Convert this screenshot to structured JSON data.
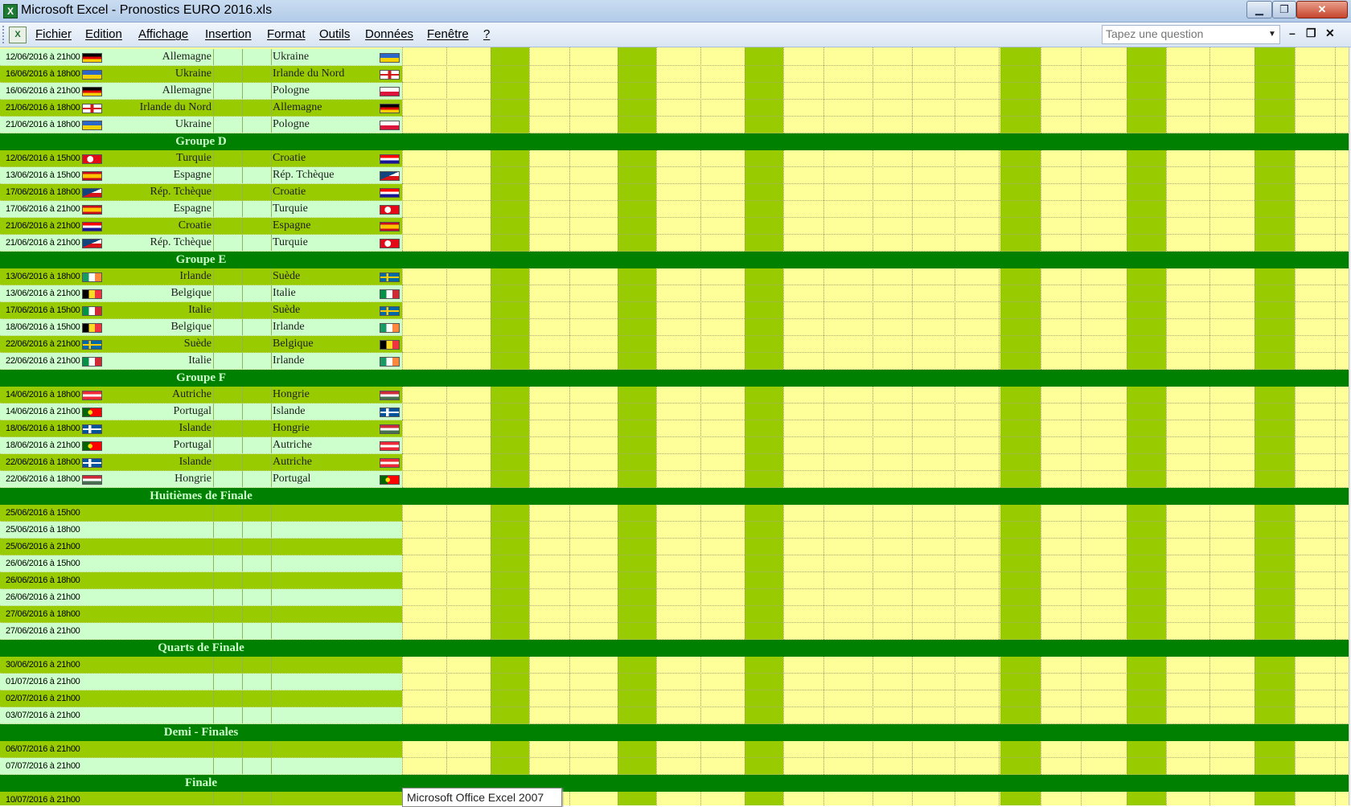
{
  "window": {
    "title": "Microsoft Excel - Pronostics EURO 2016.xls",
    "min_label": "▁",
    "max_label": "❐",
    "close_label": "✕"
  },
  "menu": {
    "items": [
      "Fichier",
      "Edition",
      "Affichage",
      "Insertion",
      "Format",
      "Outils",
      "Données",
      "Fenêtre",
      "?"
    ],
    "search_placeholder": "Tapez une question",
    "mdi_min": "–",
    "mdi_restore": "❐",
    "mdi_close": "✕"
  },
  "colors": {
    "row_light": "#ccffcc",
    "row_dark": "#99cc00",
    "group_bar": "#008000",
    "grid_bg": "#ffff99"
  },
  "sections": [
    {
      "group": null,
      "matches": [
        {
          "date": "12/06/2016 à 21h00",
          "team1": "Allemagne",
          "team2": "Ukraine",
          "flag1": "germany",
          "flag2": "ukraine"
        },
        {
          "date": "16/06/2016 à 18h00",
          "team1": "Ukraine",
          "team2": "Irlande du Nord",
          "flag1": "ukraine",
          "flag2": "northern-ireland"
        },
        {
          "date": "16/06/2016 à 21h00",
          "team1": "Allemagne",
          "team2": "Pologne",
          "flag1": "germany",
          "flag2": "poland"
        },
        {
          "date": "21/06/2016 à 18h00",
          "team1": "Irlande du Nord",
          "team2": "Allemagne",
          "flag1": "northern-ireland",
          "flag2": "germany"
        },
        {
          "date": "21/06/2016 à 18h00",
          "team1": "Ukraine",
          "team2": "Pologne",
          "flag1": "ukraine",
          "flag2": "poland"
        }
      ]
    },
    {
      "group": "Groupe D",
      "matches": [
        {
          "date": "12/06/2016 à 15h00",
          "team1": "Turquie",
          "team2": "Croatie",
          "flag1": "turkey",
          "flag2": "croatia"
        },
        {
          "date": "13/06/2016 à 15h00",
          "team1": "Espagne",
          "team2": "Rép. Tchèque",
          "flag1": "spain",
          "flag2": "czech"
        },
        {
          "date": "17/06/2016 à 18h00",
          "team1": "Rép. Tchèque",
          "team2": "Croatie",
          "flag1": "czech",
          "flag2": "croatia"
        },
        {
          "date": "17/06/2016 à 21h00",
          "team1": "Espagne",
          "team2": "Turquie",
          "flag1": "spain",
          "flag2": "turkey"
        },
        {
          "date": "21/06/2016 à 21h00",
          "team1": "Croatie",
          "team2": "Espagne",
          "flag1": "croatia",
          "flag2": "spain"
        },
        {
          "date": "21/06/2016 à 21h00",
          "team1": "Rép. Tchèque",
          "team2": "Turquie",
          "flag1": "czech",
          "flag2": "turkey"
        }
      ]
    },
    {
      "group": "Groupe E",
      "matches": [
        {
          "date": "13/06/2016 à 18h00",
          "team1": "Irlande",
          "team2": "Suède",
          "flag1": "ireland",
          "flag2": "sweden"
        },
        {
          "date": "13/06/2016 à 21h00",
          "team1": "Belgique",
          "team2": "Italie",
          "flag1": "belgium",
          "flag2": "italy"
        },
        {
          "date": "17/06/2016 à 15h00",
          "team1": "Italie",
          "team2": "Suède",
          "flag1": "italy",
          "flag2": "sweden"
        },
        {
          "date": "18/06/2016 à 15h00",
          "team1": "Belgique",
          "team2": "Irlande",
          "flag1": "belgium",
          "flag2": "ireland"
        },
        {
          "date": "22/06/2016 à 21h00",
          "team1": "Suède",
          "team2": "Belgique",
          "flag1": "sweden",
          "flag2": "belgium"
        },
        {
          "date": "22/06/2016 à 21h00",
          "team1": "Italie",
          "team2": "Irlande",
          "flag1": "italy",
          "flag2": "ireland"
        }
      ]
    },
    {
      "group": "Groupe F",
      "matches": [
        {
          "date": "14/06/2016 à 18h00",
          "team1": "Autriche",
          "team2": "Hongrie",
          "flag1": "austria",
          "flag2": "hungary"
        },
        {
          "date": "14/06/2016 à 21h00",
          "team1": "Portugal",
          "team2": "Islande",
          "flag1": "portugal",
          "flag2": "iceland"
        },
        {
          "date": "18/06/2016 à 18h00",
          "team1": "Islande",
          "team2": "Hongrie",
          "flag1": "iceland",
          "flag2": "hungary"
        },
        {
          "date": "18/06/2016 à 21h00",
          "team1": "Portugal",
          "team2": "Autriche",
          "flag1": "portugal",
          "flag2": "austria"
        },
        {
          "date": "22/06/2016 à 18h00",
          "team1": "Islande",
          "team2": "Autriche",
          "flag1": "iceland",
          "flag2": "austria"
        },
        {
          "date": "22/06/2016 à 18h00",
          "team1": "Hongrie",
          "team2": "Portugal",
          "flag1": "hungary",
          "flag2": "portugal"
        }
      ]
    },
    {
      "group": "Huitièmes de Finale",
      "matches": [
        {
          "date": "25/06/2016 à 15h00"
        },
        {
          "date": "25/06/2016 à 18h00"
        },
        {
          "date": "25/06/2016 à 21h00"
        },
        {
          "date": "26/06/2016 à 15h00"
        },
        {
          "date": "26/06/2016 à 18h00"
        },
        {
          "date": "26/06/2016 à 21h00"
        },
        {
          "date": "27/06/2016 à 18h00"
        },
        {
          "date": "27/06/2016 à 21h00"
        }
      ]
    },
    {
      "group": "Quarts de Finale",
      "matches": [
        {
          "date": "30/06/2016 à 21h00"
        },
        {
          "date": "01/07/2016 à 21h00"
        },
        {
          "date": "02/07/2016 à 21h00"
        },
        {
          "date": "03/07/2016 à 21h00"
        }
      ]
    },
    {
      "group": "Demi - Finales",
      "matches": [
        {
          "date": "06/07/2016 à 21h00"
        },
        {
          "date": "07/07/2016 à 21h00"
        }
      ]
    },
    {
      "group": "Finale",
      "matches": [
        {
          "date": "10/07/2016 à 21h00"
        }
      ]
    }
  ],
  "tooltip": "Microsoft Office Excel 2007"
}
